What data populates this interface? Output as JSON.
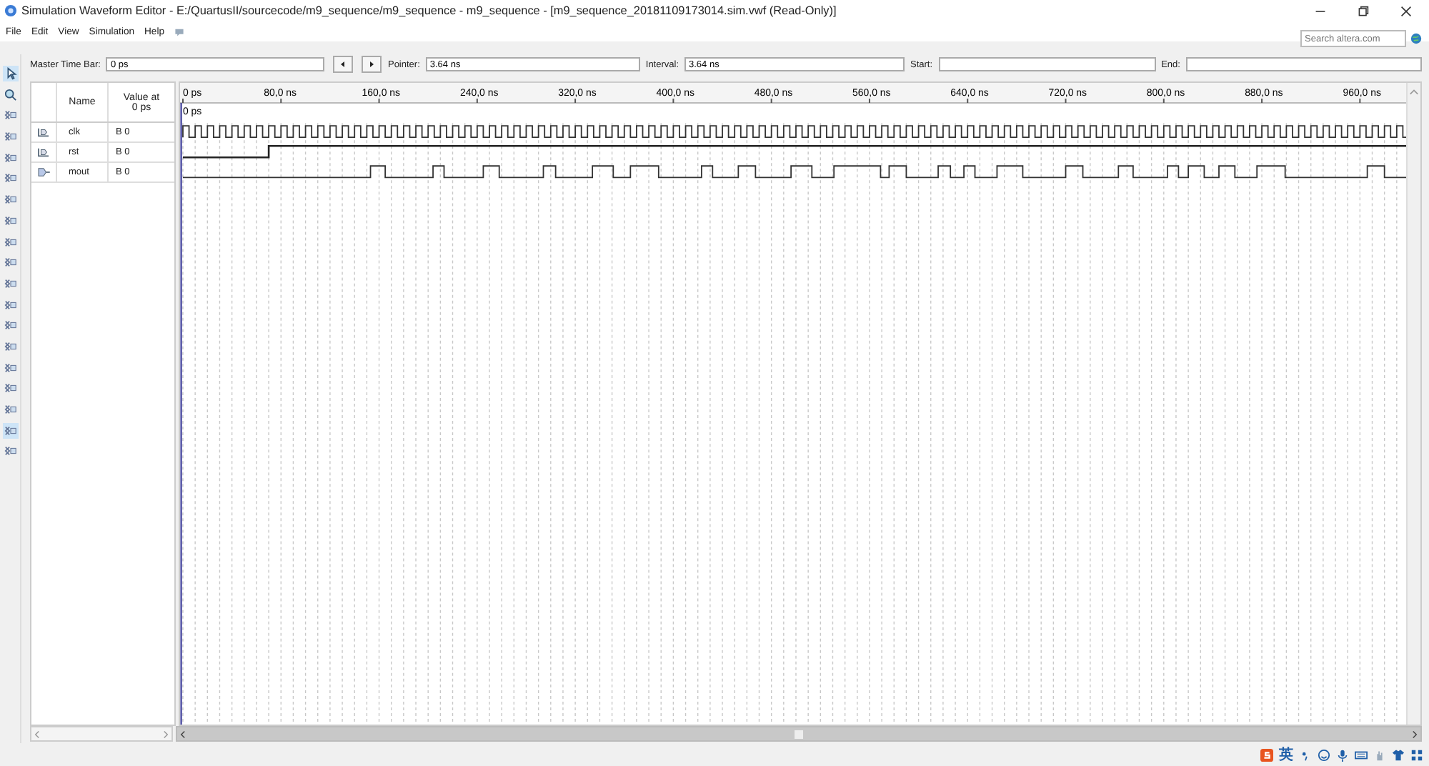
{
  "window": {
    "title": "Simulation Waveform Editor - E:/QuartusII/sourcecode/m9_sequence/m9_sequence - m9_sequence - [m9_sequence_20181109173014.sim.vwf (Read-Only)]"
  },
  "menu": [
    "File",
    "Edit",
    "View",
    "Simulation",
    "Help"
  ],
  "search": {
    "placeholder": "Search altera.com"
  },
  "time_bar": [
    {
      "label": "Master Time Bar:",
      "value": "0 ps"
    },
    {
      "label": "Pointer:",
      "value": "3.64 ns"
    },
    {
      "label": "Interval:",
      "value": "3.64 ns"
    },
    {
      "label": "Start:"
    },
    {
      "label": "End:"
    }
  ],
  "columns": {
    "name": "Name",
    "value": "Value at\n0 ps"
  },
  "ruler": [
    "0 ps",
    "80,0 ns",
    "160,0 ns",
    "240,0 ns",
    "320,0 ns",
    "400,0 ns",
    "480,0 ns",
    "560,0 ns",
    "640,0 ns",
    "720,0 ns",
    "800,0 ns",
    "880,0 ns",
    "960,0 ns"
  ],
  "cursor_label": "0 ps",
  "signals": [
    {
      "name": "clk",
      "value": "B 0",
      "kind": "clock"
    },
    {
      "name": "rst",
      "value": "B 0",
      "kind": "step"
    },
    {
      "name": "mout",
      "value": "B 0",
      "kind": "pulses"
    }
  ],
  "tray": {
    "ime": "英"
  }
}
